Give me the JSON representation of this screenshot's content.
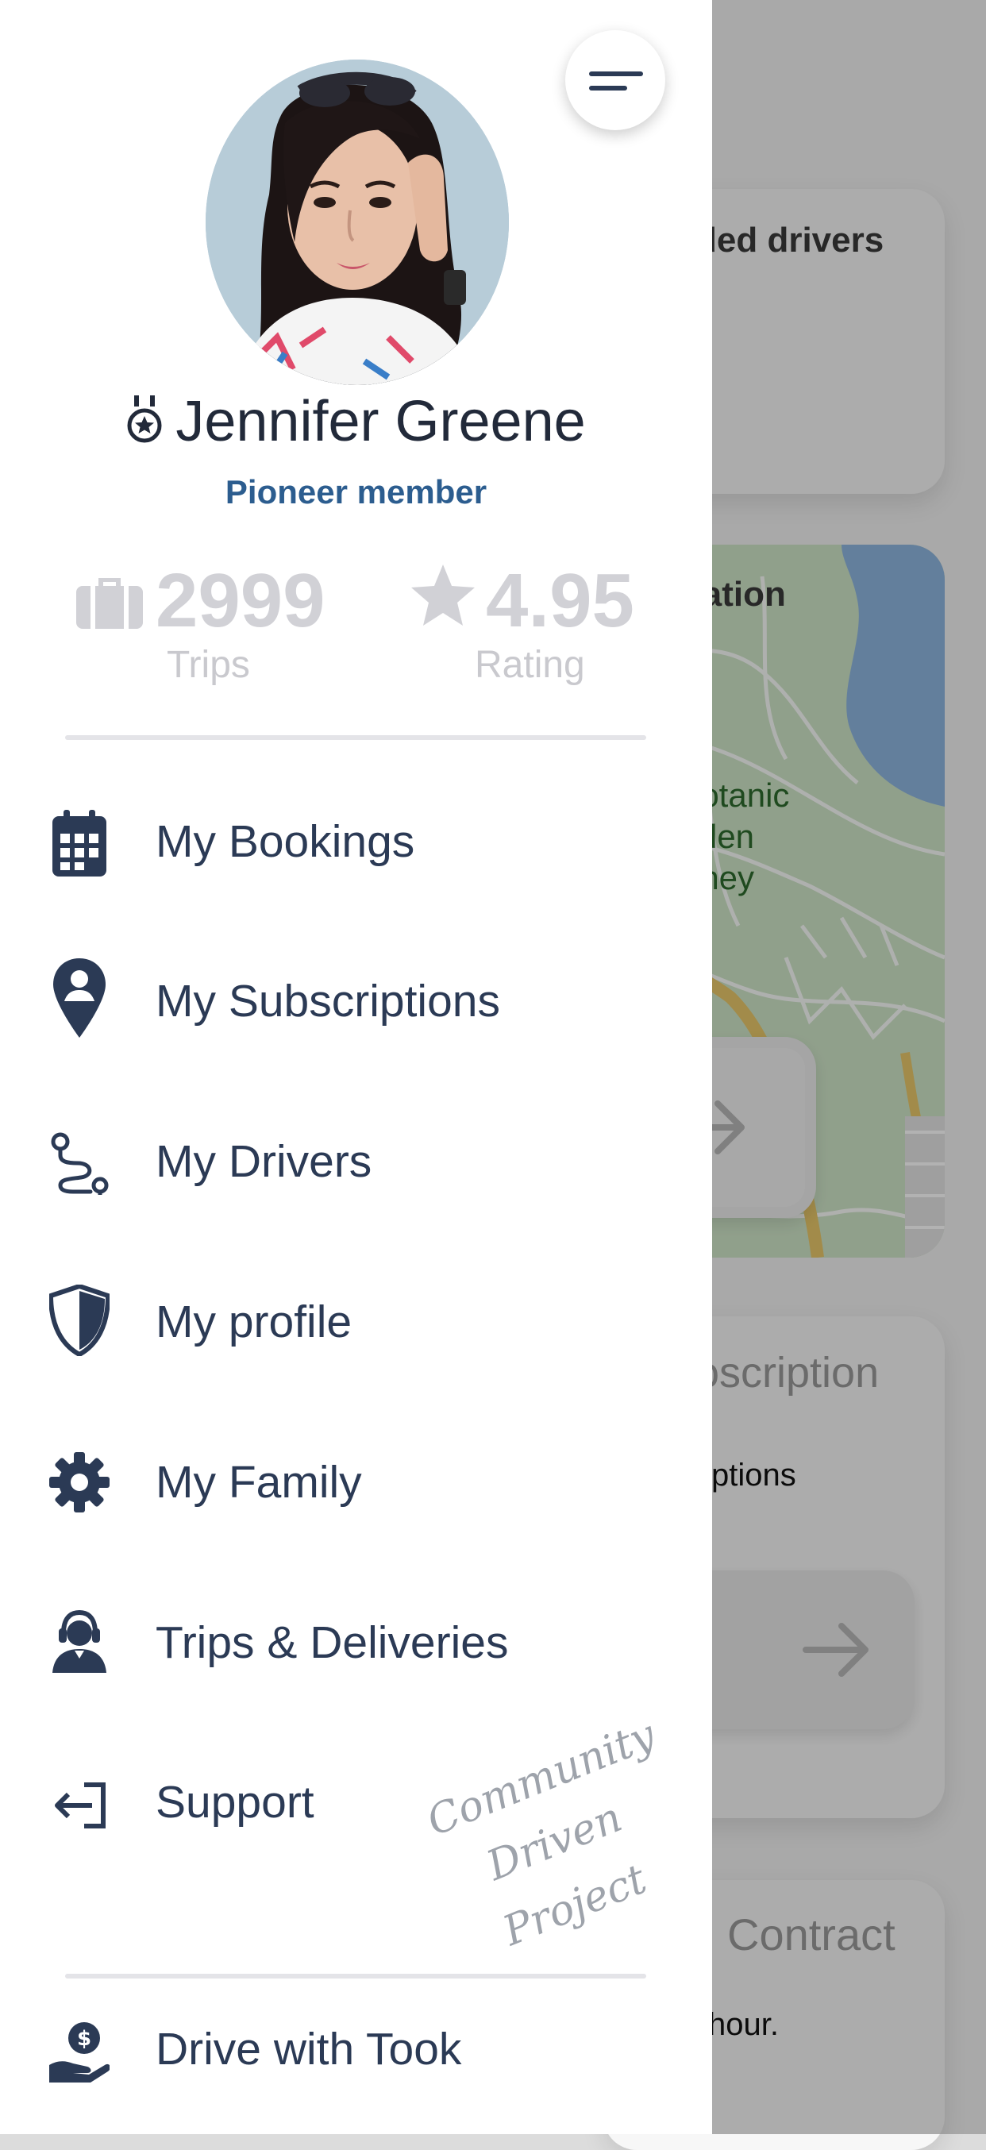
{
  "background": {
    "card1_title": "ded drivers",
    "card2_title": "ve location",
    "map_label_line1": "oyal Botanic",
    "map_label_line2": "Garden",
    "map_label_line3": "Sydney",
    "card3_title": "oscription",
    "card3_text": "ptions",
    "card4_title": "Contract",
    "card4_text": "hour."
  },
  "drawer": {
    "user": {
      "name": "Jennifer Greene",
      "tier": "Pioneer member"
    },
    "stats": [
      {
        "value": "2999",
        "label": "Trips",
        "icon": "briefcase-icon"
      },
      {
        "value": "4.95",
        "label": "Rating",
        "icon": "star-icon"
      }
    ],
    "menu": [
      {
        "label": "My Bookings",
        "icon": "calendar-icon"
      },
      {
        "label": "My Subscriptions",
        "icon": "map-pin-user-icon"
      },
      {
        "label": "My Drivers",
        "icon": "route-icon"
      },
      {
        "label": "My profile",
        "icon": "shield-icon"
      },
      {
        "label": "My Family",
        "icon": "gear-icon"
      },
      {
        "label": "Trips & Deliveries",
        "icon": "headset-agent-icon"
      },
      {
        "label": "Support",
        "icon": "sign-out-icon"
      }
    ],
    "footer_item": {
      "label": "Drive with Took",
      "icon": "hand-dollar-icon"
    },
    "watermark": {
      "line1": "Community",
      "line2": "Driven",
      "line3": "Project"
    }
  },
  "colors": {
    "accent": "#2c5d8f",
    "menu_text": "#2b3a55",
    "stat_text": "#d1d1d6"
  }
}
